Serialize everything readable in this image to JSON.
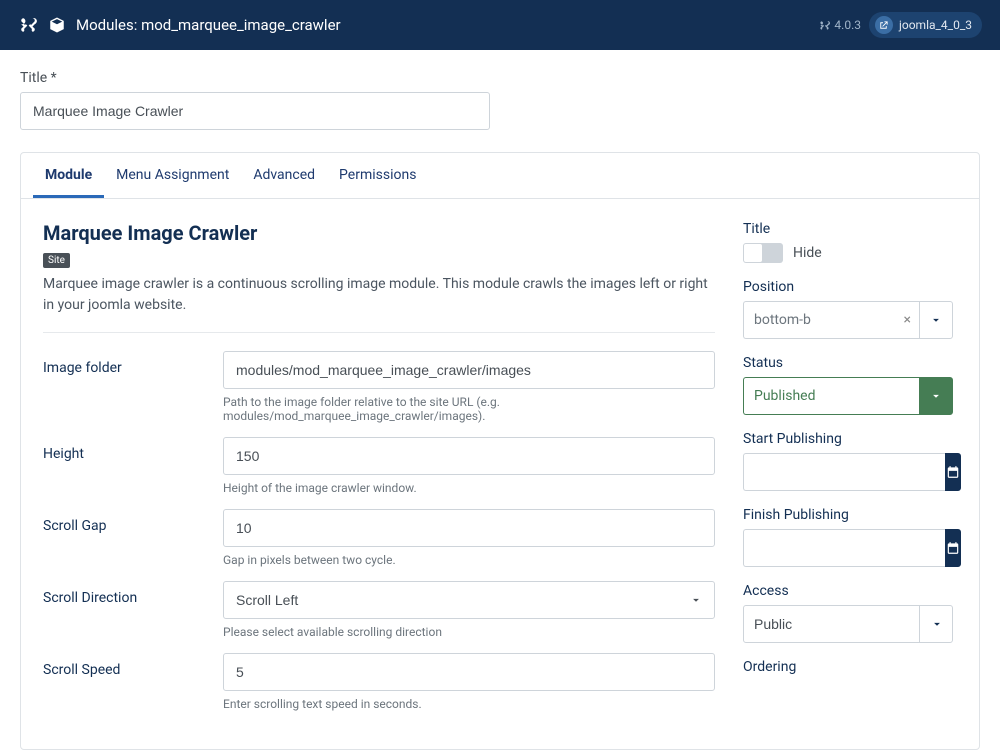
{
  "header": {
    "title": "Modules: mod_marquee_image_crawler",
    "version": "4.0.3",
    "site_name": "joomla_4_0_3"
  },
  "title_field": {
    "label": "Title *",
    "value": "Marquee Image Crawler"
  },
  "tabs": [
    {
      "label": "Module",
      "active": true
    },
    {
      "label": "Menu Assignment",
      "active": false
    },
    {
      "label": "Advanced",
      "active": false
    },
    {
      "label": "Permissions",
      "active": false
    }
  ],
  "module": {
    "heading": "Marquee Image Crawler",
    "chip": "Site",
    "description": "Marquee image crawler is a continuous scrolling image module. This module crawls the images left or right in your joomla website.",
    "fields": {
      "image_folder": {
        "label": "Image folder",
        "value": "modules/mod_marquee_image_crawler/images",
        "help": "Path to the image folder relative to the site URL (e.g. modules/mod_marquee_image_crawler/images)."
      },
      "height": {
        "label": "Height",
        "value": "150",
        "help": "Height of the image crawler window."
      },
      "scroll_gap": {
        "label": "Scroll Gap",
        "value": "10",
        "help": "Gap in pixels between two cycle."
      },
      "scroll_direction": {
        "label": "Scroll Direction",
        "value": "Scroll Left",
        "help": "Please select available scrolling direction"
      },
      "scroll_speed": {
        "label": "Scroll Speed",
        "value": "5",
        "help": "Enter scrolling text speed in seconds."
      }
    }
  },
  "sidebar": {
    "title": {
      "label": "Title",
      "toggle_text": "Hide"
    },
    "position": {
      "label": "Position",
      "value": "bottom-b"
    },
    "status": {
      "label": "Status",
      "value": "Published"
    },
    "start_publishing": {
      "label": "Start Publishing",
      "value": ""
    },
    "finish_publishing": {
      "label": "Finish Publishing",
      "value": ""
    },
    "access": {
      "label": "Access",
      "value": "Public"
    },
    "ordering": {
      "label": "Ordering"
    }
  }
}
